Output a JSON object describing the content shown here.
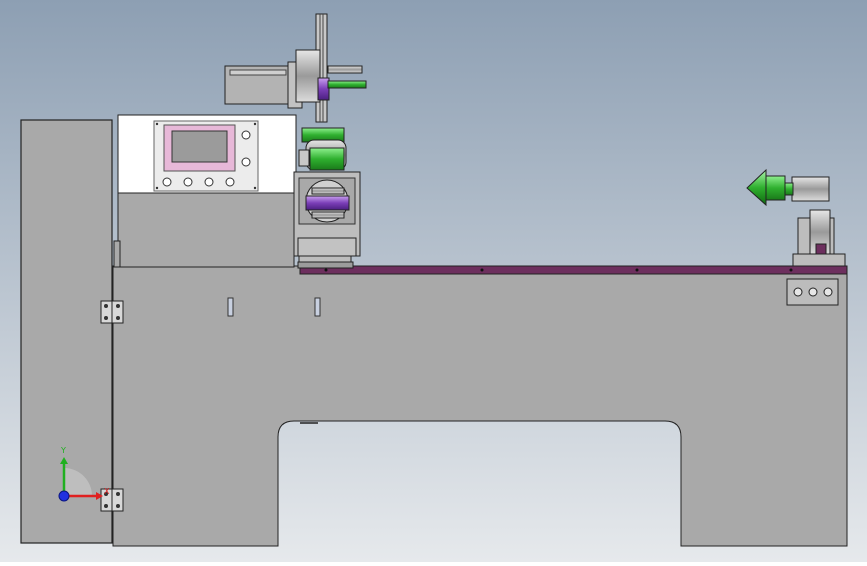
{
  "viewport": {
    "background_top": "#8d9fb3",
    "background_bottom": "#e6e9ec",
    "body_color": "#a9a9a9",
    "outline_color": "#222222",
    "rail_color": "#6d2f5e",
    "accent_green": "#2fb02f",
    "accent_purple": "#7b3fb8",
    "screen_frame_color": "#e7b8d8"
  },
  "triad": {
    "x_label": "X",
    "y_label": "Y",
    "x_color": "#e02020",
    "y_color": "#20b020",
    "z_color": "#2030e0"
  }
}
